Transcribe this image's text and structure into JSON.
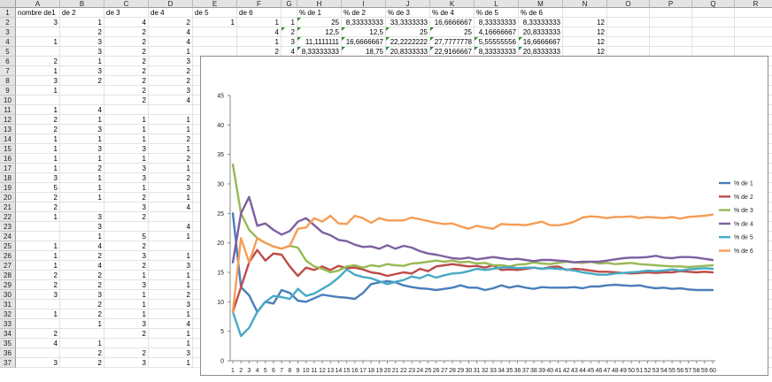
{
  "columns": [
    "A",
    "B",
    "C",
    "D",
    "E",
    "F",
    "G",
    "H",
    "I",
    "J",
    "K",
    "L",
    "M",
    "N",
    "O",
    "P",
    "Q",
    "R"
  ],
  "rows": [
    [
      "nombre de1",
      "de 2",
      "de 3",
      "de 4",
      "de 5",
      "de 6",
      "",
      "% de 1",
      "% de 2",
      "% de 3",
      "% de 4",
      "% de 5",
      "% de 6",
      "",
      "",
      "",
      "",
      ""
    ],
    [
      "3",
      "1",
      "4",
      "2",
      "1",
      "1",
      "1",
      "25",
      "8,33333333",
      "33,3333333",
      "16,6666667",
      "8,33333333",
      "8,33333333",
      "12",
      "",
      "",
      "",
      ""
    ],
    [
      "",
      "2",
      "2",
      "4",
      "",
      "4",
      "2",
      "12,5",
      "12,5",
      "25",
      "25",
      "4,16666667",
      "20,8333333",
      "12",
      "",
      "",
      "",
      ""
    ],
    [
      "1",
      "3",
      "2",
      "4",
      "",
      "1",
      "3",
      "11,1111111",
      "16,6666667",
      "22,2222222",
      "27,7777778",
      "5,55555556",
      "16,6666667",
      "12",
      "",
      "",
      "",
      ""
    ],
    [
      "",
      "3",
      "2",
      "1",
      "",
      "2",
      "4",
      "8,33333333",
      "18,75",
      "20,8333333",
      "22,9166667",
      "8,33333333",
      "20,8333333",
      "12",
      "",
      "",
      "",
      ""
    ],
    [
      "2",
      "1",
      "2",
      "3",
      "",
      "",
      "",
      "",
      "",
      "",
      "",
      "",
      "",
      "",
      "",
      "",
      "",
      ""
    ],
    [
      "1",
      "3",
      "2",
      "2",
      "",
      "",
      "",
      "",
      "",
      "",
      "",
      "",
      "",
      "",
      "",
      "",
      "",
      ""
    ],
    [
      "3",
      "2",
      "2",
      "2",
      "",
      "",
      "",
      "",
      "",
      "",
      "",
      "",
      "",
      "",
      "",
      "",
      "",
      ""
    ],
    [
      "1",
      "",
      "2",
      "3",
      "",
      "",
      "",
      "",
      "",
      "",
      "",
      "",
      "",
      "",
      "",
      "",
      "",
      ""
    ],
    [
      "",
      "",
      "2",
      "4",
      "",
      "",
      "",
      "",
      "",
      "",
      "",
      "",
      "",
      "",
      "",
      "",
      "",
      ""
    ],
    [
      "1",
      "4",
      "",
      "",
      "",
      "",
      "",
      "",
      "",
      "",
      "",
      "",
      "",
      "",
      "",
      "",
      "",
      ""
    ],
    [
      "2",
      "1",
      "1",
      "1",
      "",
      "",
      "",
      "",
      "",
      "",
      "",
      "",
      "",
      "",
      "",
      "",
      "",
      ""
    ],
    [
      "2",
      "3",
      "1",
      "1",
      "",
      "",
      "",
      "",
      "",
      "",
      "",
      "",
      "",
      "",
      "",
      "",
      "",
      ""
    ],
    [
      "1",
      "1",
      "1",
      "2",
      "",
      "",
      "",
      "",
      "",
      "",
      "",
      "",
      "",
      "",
      "",
      "",
      "",
      ""
    ],
    [
      "1",
      "3",
      "3",
      "1",
      "",
      "",
      "",
      "",
      "",
      "",
      "",
      "",
      "",
      "",
      "",
      "",
      "",
      ""
    ],
    [
      "1",
      "1",
      "1",
      "2",
      "",
      "",
      "",
      "",
      "",
      "",
      "",
      "",
      "",
      "",
      "",
      "",
      "",
      ""
    ],
    [
      "1",
      "2",
      "3",
      "1",
      "",
      "",
      "",
      "",
      "",
      "",
      "",
      "",
      "",
      "",
      "",
      "",
      "",
      ""
    ],
    [
      "3",
      "1",
      "3",
      "2",
      "",
      "",
      "",
      "",
      "",
      "",
      "",
      "",
      "",
      "",
      "",
      "",
      "",
      ""
    ],
    [
      "5",
      "1",
      "1",
      "3",
      "",
      "",
      "",
      "",
      "",
      "",
      "",
      "",
      "",
      "",
      "",
      "",
      "",
      ""
    ],
    [
      "2",
      "1",
      "2",
      "1",
      "",
      "",
      "",
      "",
      "",
      "",
      "",
      "",
      "",
      "",
      "",
      "",
      "",
      ""
    ],
    [
      "2",
      "",
      "3",
      "4",
      "",
      "",
      "",
      "",
      "",
      "",
      "",
      "",
      "",
      "",
      "",
      "",
      "",
      ""
    ],
    [
      "1",
      "3",
      "2",
      "",
      "",
      "",
      "",
      "",
      "",
      "",
      "",
      "",
      "",
      "",
      "",
      "",
      "",
      ""
    ],
    [
      "",
      "3",
      "",
      "4",
      "",
      "",
      "",
      "",
      "",
      "",
      "",
      "",
      "",
      "",
      "",
      "",
      "",
      ""
    ],
    [
      "",
      "1",
      "5",
      "1",
      "",
      "",
      "",
      "",
      "",
      "",
      "",
      "",
      "",
      "",
      "",
      "",
      "",
      ""
    ],
    [
      "1",
      "4",
      "2",
      "",
      "",
      "",
      "",
      "",
      "",
      "",
      "",
      "",
      "",
      "",
      "",
      "",
      "",
      ""
    ],
    [
      "1",
      "2",
      "3",
      "1",
      "",
      "",
      "",
      "",
      "",
      "",
      "",
      "",
      "",
      "",
      "",
      "",
      "",
      ""
    ],
    [
      "1",
      "4",
      "2",
      "3",
      "",
      "",
      "",
      "",
      "",
      "",
      "",
      "",
      "",
      "",
      "",
      "",
      "",
      ""
    ],
    [
      "2",
      "2",
      "1",
      "1",
      "",
      "",
      "",
      "",
      "",
      "",
      "",
      "",
      "",
      "",
      "",
      "",
      "",
      ""
    ],
    [
      "2",
      "2",
      "3",
      "1",
      "",
      "",
      "",
      "",
      "",
      "",
      "",
      "",
      "",
      "",
      "",
      "",
      "",
      ""
    ],
    [
      "3",
      "3",
      "1",
      "2",
      "",
      "",
      "",
      "",
      "",
      "",
      "",
      "",
      "",
      "",
      "",
      "",
      "",
      ""
    ],
    [
      "",
      "2",
      "1",
      "3",
      "",
      "",
      "",
      "",
      "",
      "",
      "",
      "",
      "",
      "",
      "",
      "",
      "",
      ""
    ],
    [
      "1",
      "2",
      "1",
      "1",
      "",
      "",
      "",
      "",
      "",
      "",
      "",
      "",
      "",
      "",
      "",
      "",
      "",
      ""
    ],
    [
      "",
      "1",
      "3",
      "4",
      "",
      "",
      "",
      "",
      "",
      "",
      "",
      "",
      "",
      "",
      "",
      "",
      "",
      ""
    ],
    [
      "2",
      "",
      "2",
      "1",
      "",
      "",
      "",
      "",
      "",
      "",
      "",
      "",
      "",
      "",
      "",
      "",
      "",
      ""
    ],
    [
      "4",
      "1",
      "",
      "1",
      "",
      "",
      "",
      "",
      "",
      "",
      "",
      "",
      "",
      "",
      "",
      "",
      "",
      ""
    ],
    [
      "",
      "2",
      "2",
      "3",
      "",
      "",
      "",
      "",
      "",
      "",
      "",
      "",
      "",
      "",
      "",
      "",
      "",
      ""
    ],
    [
      "3",
      "2",
      "3",
      "1",
      "",
      "",
      "",
      "",
      "",
      "",
      "",
      "",
      "",
      "",
      "",
      "",
      "",
      ""
    ]
  ],
  "chart_data": {
    "type": "line",
    "title": "",
    "xlabel": "",
    "ylabel": "",
    "ylim": [
      0,
      45
    ],
    "yticks": [
      0,
      5,
      10,
      15,
      20,
      25,
      30,
      35,
      40,
      45
    ],
    "grid": false,
    "legend": "right",
    "x": [
      1,
      2,
      3,
      4,
      5,
      6,
      7,
      8,
      9,
      10,
      11,
      12,
      13,
      14,
      15,
      16,
      17,
      18,
      19,
      20,
      21,
      22,
      23,
      24,
      25,
      26,
      27,
      28,
      29,
      30,
      31,
      32,
      33,
      34,
      35,
      36,
      37,
      38,
      39,
      40,
      41,
      42,
      43,
      44,
      45,
      46,
      47,
      48,
      49,
      50,
      51,
      52,
      53,
      54,
      55,
      56,
      57,
      58,
      59,
      60
    ],
    "series": [
      {
        "name": "% de 1",
        "color": "#4a7ebb",
        "values": [
          25,
          12.5,
          11.1,
          8.3,
          10,
          9.7,
          12,
          11.5,
          10.2,
          10,
          10.6,
          11.2,
          11,
          10.8,
          10.7,
          10.5,
          11.5,
          13,
          13.3,
          13.5,
          13.3,
          12.8,
          12.5,
          12.3,
          12.2,
          12,
          12.2,
          12.4,
          12.8,
          12.4,
          12.4,
          12,
          12.3,
          12.8,
          12.4,
          12.7,
          12.4,
          12.2,
          12.5,
          12.4,
          12.4,
          12.4,
          12.5,
          12.3,
          12.6,
          12.6,
          12.8,
          12.9,
          12.8,
          12.7,
          12.8,
          12.5,
          12.3,
          12.4,
          12.2,
          12.3,
          12.1,
          12,
          12,
          12
        ]
      },
      {
        "name": "% de 2",
        "color": "#be4b48",
        "values": [
          8.3,
          12.5,
          16.7,
          18.8,
          17,
          18.2,
          18,
          16,
          14.4,
          15.8,
          15.4,
          16,
          15.4,
          16.1,
          15.7,
          15.8,
          15.5,
          15,
          14.8,
          14.4,
          14.7,
          15,
          14.8,
          15.6,
          15.2,
          16,
          16.2,
          16.4,
          16.2,
          16,
          16.1,
          15.8,
          16.2,
          15.4,
          15.5,
          15.4,
          15.6,
          15.8,
          15.6,
          15.9,
          16,
          15.4,
          15.6,
          15.5,
          15.3,
          15.1,
          15.1,
          15,
          14.9,
          14.8,
          14.9,
          15,
          14.9,
          15,
          15,
          15.2,
          15.1,
          15,
          15.1,
          15
        ]
      },
      {
        "name": "% de 3",
        "color": "#98b954",
        "values": [
          33.3,
          25,
          22.2,
          20.8,
          20,
          19.4,
          19,
          19.5,
          19.2,
          17,
          16,
          15.6,
          15,
          15.3,
          16,
          16.2,
          15.8,
          16.2,
          16,
          16.4,
          16.2,
          16.1,
          16.5,
          16.6,
          16.8,
          17,
          16.8,
          17,
          16.7,
          16.8,
          16.5,
          16.6,
          16.2,
          16.2,
          16,
          16.3,
          16.4,
          16.7,
          16.5,
          16.4,
          16.6,
          16.8,
          16.7,
          16.6,
          16.8,
          16.5,
          16.6,
          16.4,
          16.5,
          16.6,
          16.4,
          16.3,
          16.2,
          16.1,
          16,
          16,
          15.9,
          16,
          16.1,
          16.2
        ]
      },
      {
        "name": "% de 4",
        "color": "#7d60a0",
        "values": [
          16.7,
          25,
          27.8,
          22.9,
          23.3,
          22.2,
          21.4,
          22,
          23.6,
          24.2,
          23,
          21.8,
          21.3,
          20.5,
          20.3,
          19.7,
          19.3,
          19.4,
          19,
          19.6,
          19,
          19.5,
          19.2,
          18.6,
          18.2,
          18,
          17.7,
          17.4,
          17.3,
          17.5,
          17.2,
          17.4,
          17.6,
          17.4,
          17.2,
          17.3,
          17.1,
          16.9,
          17.1,
          17.1,
          17,
          16.9,
          16.7,
          16.8,
          16.8,
          16.8,
          17,
          17.2,
          17.4,
          17.5,
          17.5,
          17.6,
          17.8,
          17.5,
          17.4,
          17.6,
          17.6,
          17.5,
          17.3,
          17.1
        ]
      },
      {
        "name": "% de 5",
        "color": "#46aac5",
        "values": [
          8.3,
          4.2,
          5.6,
          8.3,
          10,
          11,
          10.8,
          10.5,
          12.2,
          11,
          11.4,
          12.2,
          13,
          14.1,
          15.5,
          14.6,
          14.2,
          14,
          13.5,
          13,
          13.4,
          13.7,
          14.3,
          14,
          14.6,
          14.1,
          14.5,
          14.8,
          14.9,
          15.2,
          15.6,
          15.4,
          15.6,
          15.8,
          15.9,
          15.7,
          15.8,
          15.8,
          15.6,
          15.7,
          15.6,
          15.5,
          15.3,
          15,
          14.8,
          14.6,
          14.6,
          14.8,
          14.9,
          15,
          15.1,
          15.3,
          15.2,
          15.3,
          15.5,
          15.3,
          15.5,
          15.6,
          15.7,
          15.6
        ]
      },
      {
        "name": "% de 6",
        "color": "#f59d56",
        "values": [
          8.3,
          20.8,
          16.7,
          20.8,
          20,
          19.4,
          19,
          19.5,
          22.4,
          22.6,
          24.2,
          23.6,
          24.6,
          23.3,
          23.2,
          24.6,
          24.2,
          23.4,
          24.2,
          23.8,
          23.8,
          23.8,
          24.3,
          24,
          23.7,
          23.4,
          23.2,
          23.3,
          22.8,
          22.4,
          22.9,
          22.6,
          22.4,
          23.2,
          23.1,
          23.1,
          23,
          23.3,
          23.6,
          23,
          23,
          23.2,
          23.6,
          24.3,
          24.5,
          24.4,
          24.2,
          24.4,
          24.4,
          24.5,
          24.2,
          24.4,
          24.3,
          24.2,
          24.4,
          24.1,
          24.4,
          24.5,
          24.6,
          24.8
        ]
      }
    ]
  }
}
